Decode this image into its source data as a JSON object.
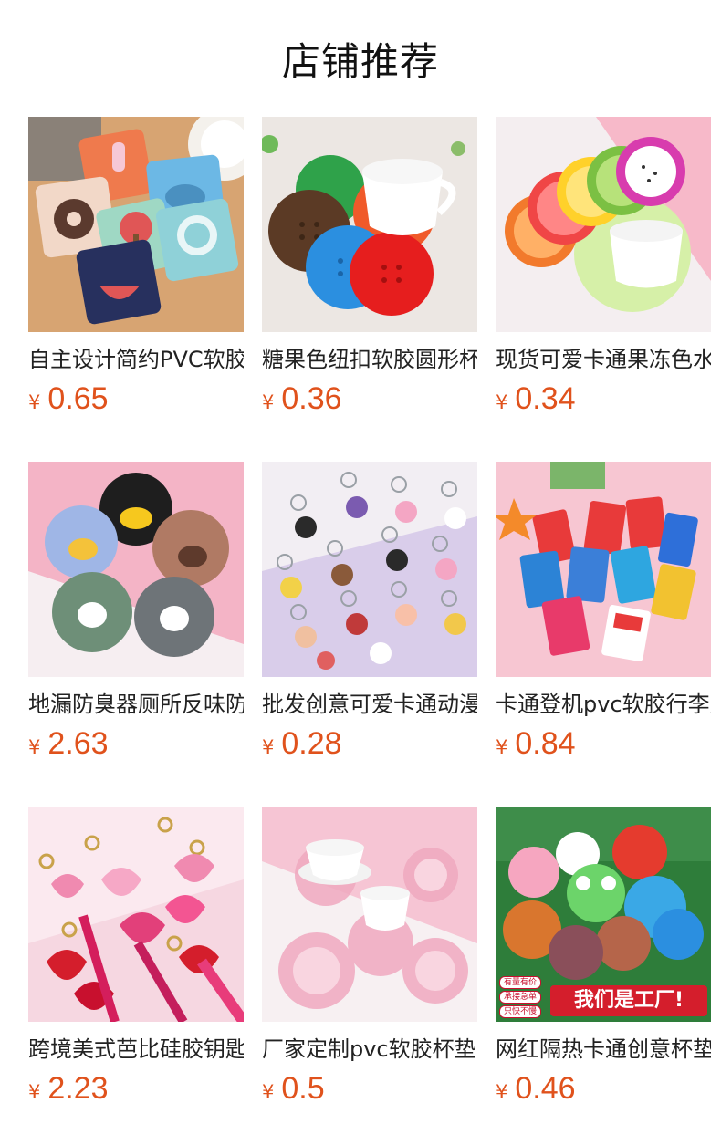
{
  "page": {
    "title": "店铺推荐"
  },
  "products": [
    {
      "name": "自主设计简约PVC软胶杯垫",
      "currency": "¥",
      "price": "0.65",
      "image": "cartoon-coasters-image"
    },
    {
      "name": "糖果色纽扣软胶圆形杯垫",
      "currency": "¥",
      "price": "0.36",
      "image": "button-coasters-image"
    },
    {
      "name": "现货可爱卡通果冻色水果杯垫",
      "currency": "¥",
      "price": "0.34",
      "image": "fruit-coasters-image"
    },
    {
      "name": "地漏防臭器厕所反味防虫",
      "currency": "¥",
      "price": "2.63",
      "image": "paw-drain-covers-image"
    },
    {
      "name": "批发创意可爱卡通动漫钥匙扣",
      "currency": "¥",
      "price": "0.28",
      "image": "keychains-image"
    },
    {
      "name": "卡通登机pvc软胶行李牌",
      "currency": "¥",
      "price": "0.84",
      "image": "luggage-tags-image"
    },
    {
      "name": "跨境美式芭比硅胶钥匙扣",
      "currency": "¥",
      "price": "2.23",
      "image": "barbie-keychains-image"
    },
    {
      "name": "厂家定制pvc软胶杯垫",
      "currency": "¥",
      "price": "0.5",
      "image": "sakura-coasters-image"
    },
    {
      "name": "网红隔热卡通创意杯垫",
      "currency": "¥",
      "price": "0.46",
      "image": "animal-coasters-image"
    }
  ],
  "banner_badges": [
    "有量有价",
    "承接急单",
    "只快不慢"
  ],
  "banner_text": "我们是工厂!",
  "colors": {
    "price": "#e0521c",
    "title": "#111111"
  }
}
